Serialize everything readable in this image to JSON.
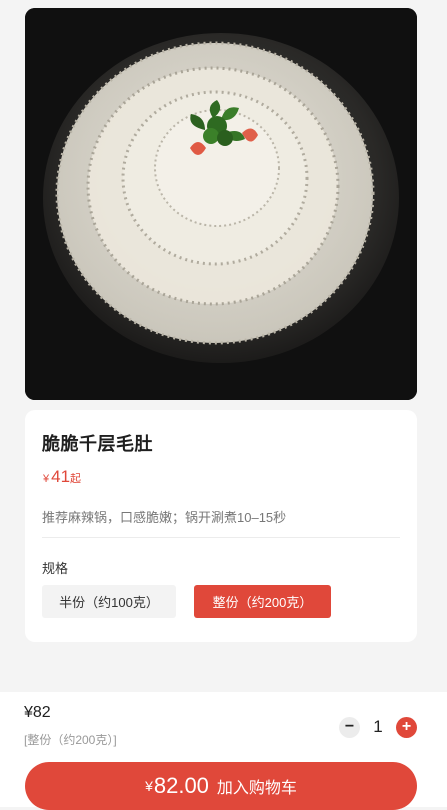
{
  "product": {
    "image_icon": "tripe-plate-photo",
    "name": "脆脆千层毛肚",
    "price": {
      "currency": "¥",
      "value": "41",
      "suffix": "起"
    },
    "description": "推荐麻辣锅，口感脆嫩；锅开涮煮10–15秒"
  },
  "spec": {
    "label": "规格",
    "options": [
      {
        "label": "半份（约100克）",
        "selected": false
      },
      {
        "label": "整份（约200克）",
        "selected": true
      }
    ]
  },
  "bottom_bar": {
    "price": "¥82",
    "selected_spec": "[整份（约200克）]",
    "quantity": "1",
    "minus_icon": "minus-icon",
    "plus_icon": "plus-icon",
    "cart_button": {
      "currency": "¥",
      "total": "82.00",
      "label": "加入购物车"
    }
  },
  "colors": {
    "accent": "#e0483a",
    "background": "#f4f4f4"
  }
}
